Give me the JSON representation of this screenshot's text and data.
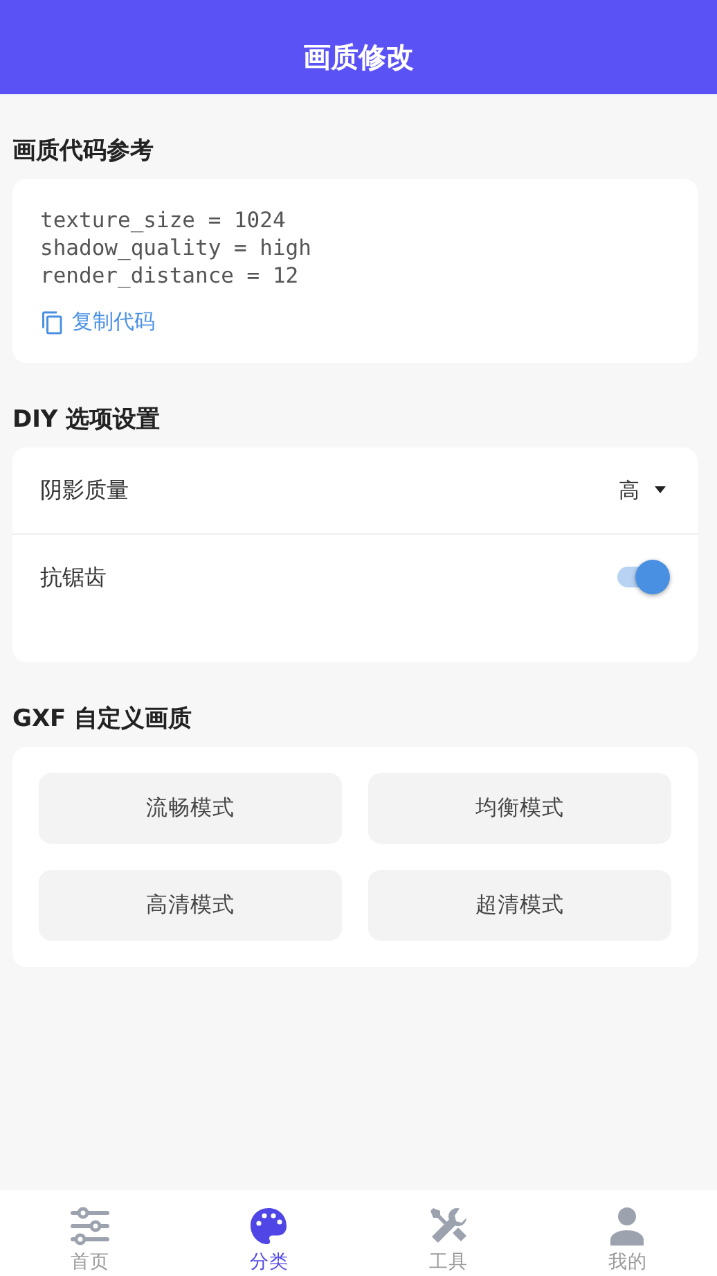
{
  "header": {
    "title": "画质修改"
  },
  "code_section": {
    "title": "画质代码参考",
    "lines": [
      "texture_size = 1024",
      "shadow_quality = high",
      "render_distance = 12"
    ],
    "copy_link": "复制代码"
  },
  "diy_section": {
    "title": "DIY 选项设置",
    "settings": [
      {
        "kind": "dropdown",
        "label": "阴影质量",
        "value": "高"
      },
      {
        "kind": "toggle",
        "label": "抗锯齿",
        "on": true
      }
    ]
  },
  "gxf_section": {
    "title": "GXF 自定义画质",
    "modes": [
      "流畅模式",
      "均衡模式",
      "高清模式",
      "超清模式"
    ]
  },
  "bottom_nav": [
    {
      "label": "首页",
      "selected": false
    },
    {
      "label": "分类",
      "selected": true
    },
    {
      "label": "工具",
      "selected": false
    },
    {
      "label": "我的",
      "selected": false
    }
  ]
}
